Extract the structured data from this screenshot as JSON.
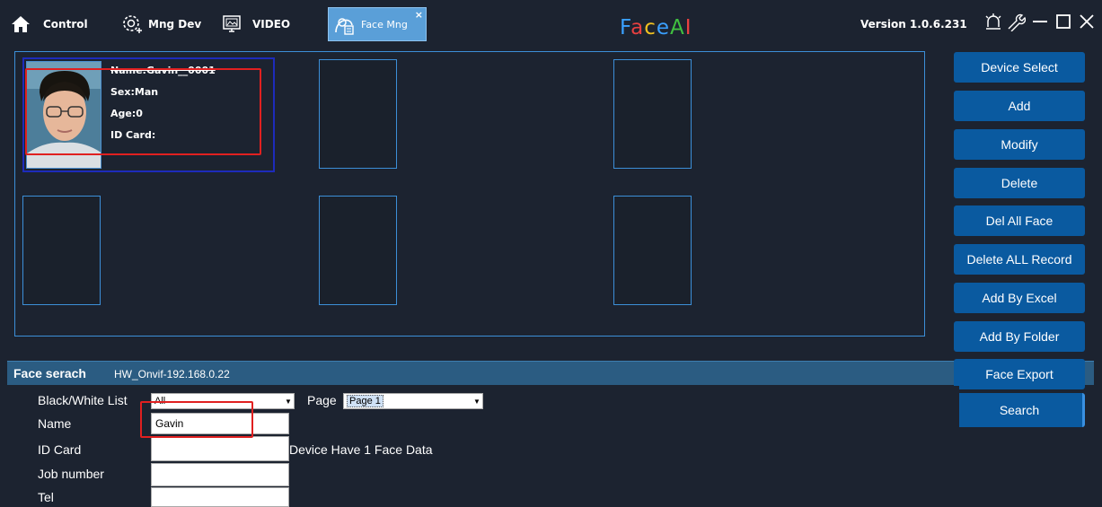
{
  "titlebar": {
    "tabs": [
      {
        "label": "Control",
        "icon": "home-icon"
      },
      {
        "label": "Mng Dev",
        "icon": "device-settings-icon"
      },
      {
        "label": "VIDEO",
        "icon": "video-monitor-icon"
      },
      {
        "label": "Face Mng",
        "icon": "face-manage-icon",
        "close": "×"
      }
    ],
    "brand": [
      "F",
      "a",
      "c",
      "e",
      "A",
      "I"
    ],
    "brand_colors": [
      "#3aa0ff",
      "#e84040",
      "#f0c020",
      "#3aa0ff",
      "#40c040",
      "#e84040"
    ],
    "version": "Version 1.0.6.231"
  },
  "face_card": {
    "name": "Name:Gavin__0001",
    "sex": "Sex:Man",
    "age": "Age:0",
    "id_card": "ID Card:"
  },
  "side_buttons": [
    "Device Select",
    "Add",
    "Modify",
    "Delete",
    "Del All Face",
    "Delete ALL Record",
    "Add By Excel",
    "Add By Folder",
    "Face Export",
    "Search"
  ],
  "search": {
    "title": "Face serach",
    "device": "HW_Onvif-192.168.0.22",
    "list_label": "Black/White List",
    "list_value": "All",
    "page_label": "Page",
    "page_value": "Page 1",
    "name_label": "Name",
    "name_value": "Gavin",
    "idcard_label": "ID Card",
    "idcard_value": "",
    "job_label": "Job number",
    "job_value": "",
    "tel_label": "Tel",
    "tel_value": "",
    "status": "Device Have 1 Face Data"
  },
  "colors": {
    "accent": "#0a5aa0",
    "highlight": "#e02020",
    "panel_border": "#3c8fd8"
  }
}
